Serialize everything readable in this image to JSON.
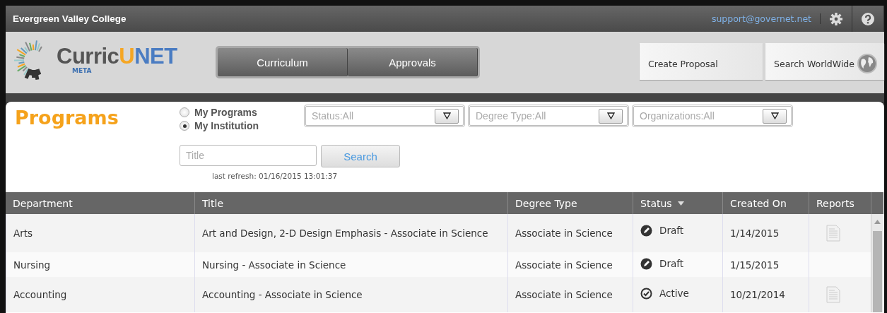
{
  "topbar": {
    "institution": "Evergreen Valley College",
    "email": "support@governet.net"
  },
  "logo": {
    "parts": [
      {
        "text": "Curric",
        "color": "#555555"
      },
      {
        "text": "U",
        "color": "#f5a623"
      },
      {
        "text": "NET",
        "color": "#4a7cc2"
      }
    ],
    "sub": "META"
  },
  "nav_tabs": [
    {
      "label": "Curriculum",
      "selected": false
    },
    {
      "label": "Approvals",
      "selected": false
    }
  ],
  "actions": [
    {
      "label": "Create Proposal",
      "kind": "plain"
    },
    {
      "label": "Search WorldWide",
      "kind": "globe"
    }
  ],
  "page_title": "Programs",
  "scope": [
    {
      "label": "My Programs",
      "selected": false
    },
    {
      "label": "My Institution",
      "selected": true
    }
  ],
  "filters": [
    {
      "placeholder": "Status:All"
    },
    {
      "placeholder": "Degree Type:All"
    },
    {
      "placeholder": "Organizations:All"
    }
  ],
  "search": {
    "placeholder": "Title",
    "button": "Search",
    "last_refresh": "last refresh: 01/16/2015 13:01:37"
  },
  "table": {
    "columns": [
      {
        "label": "Department",
        "sorted": false
      },
      {
        "label": "Title",
        "sorted": false
      },
      {
        "label": "Degree Type",
        "sorted": false
      },
      {
        "label": "Status",
        "sorted": true
      },
      {
        "label": "Created On",
        "sorted": false
      },
      {
        "label": "Reports",
        "sorted": false
      }
    ],
    "rows": [
      {
        "department": "Arts",
        "title": "Art and Design, 2-D Design Emphasis - Associate in Science",
        "degree_type": "Associate in Science",
        "status": {
          "text": "Draft",
          "kind": "draft"
        },
        "created_on": "1/14/2015",
        "has_report": true
      },
      {
        "department": "Nursing",
        "title": "Nursing - Associate in Science",
        "degree_type": "Associate in Science",
        "status": {
          "text": "Draft",
          "kind": "draft"
        },
        "created_on": "1/15/2015",
        "has_report": false
      },
      {
        "department": "Accounting",
        "title": "Accounting - Associate in Science",
        "degree_type": "Associate in Science",
        "status": {
          "text": "Active",
          "kind": "active"
        },
        "created_on": "10/21/2014",
        "has_report": true
      }
    ]
  }
}
